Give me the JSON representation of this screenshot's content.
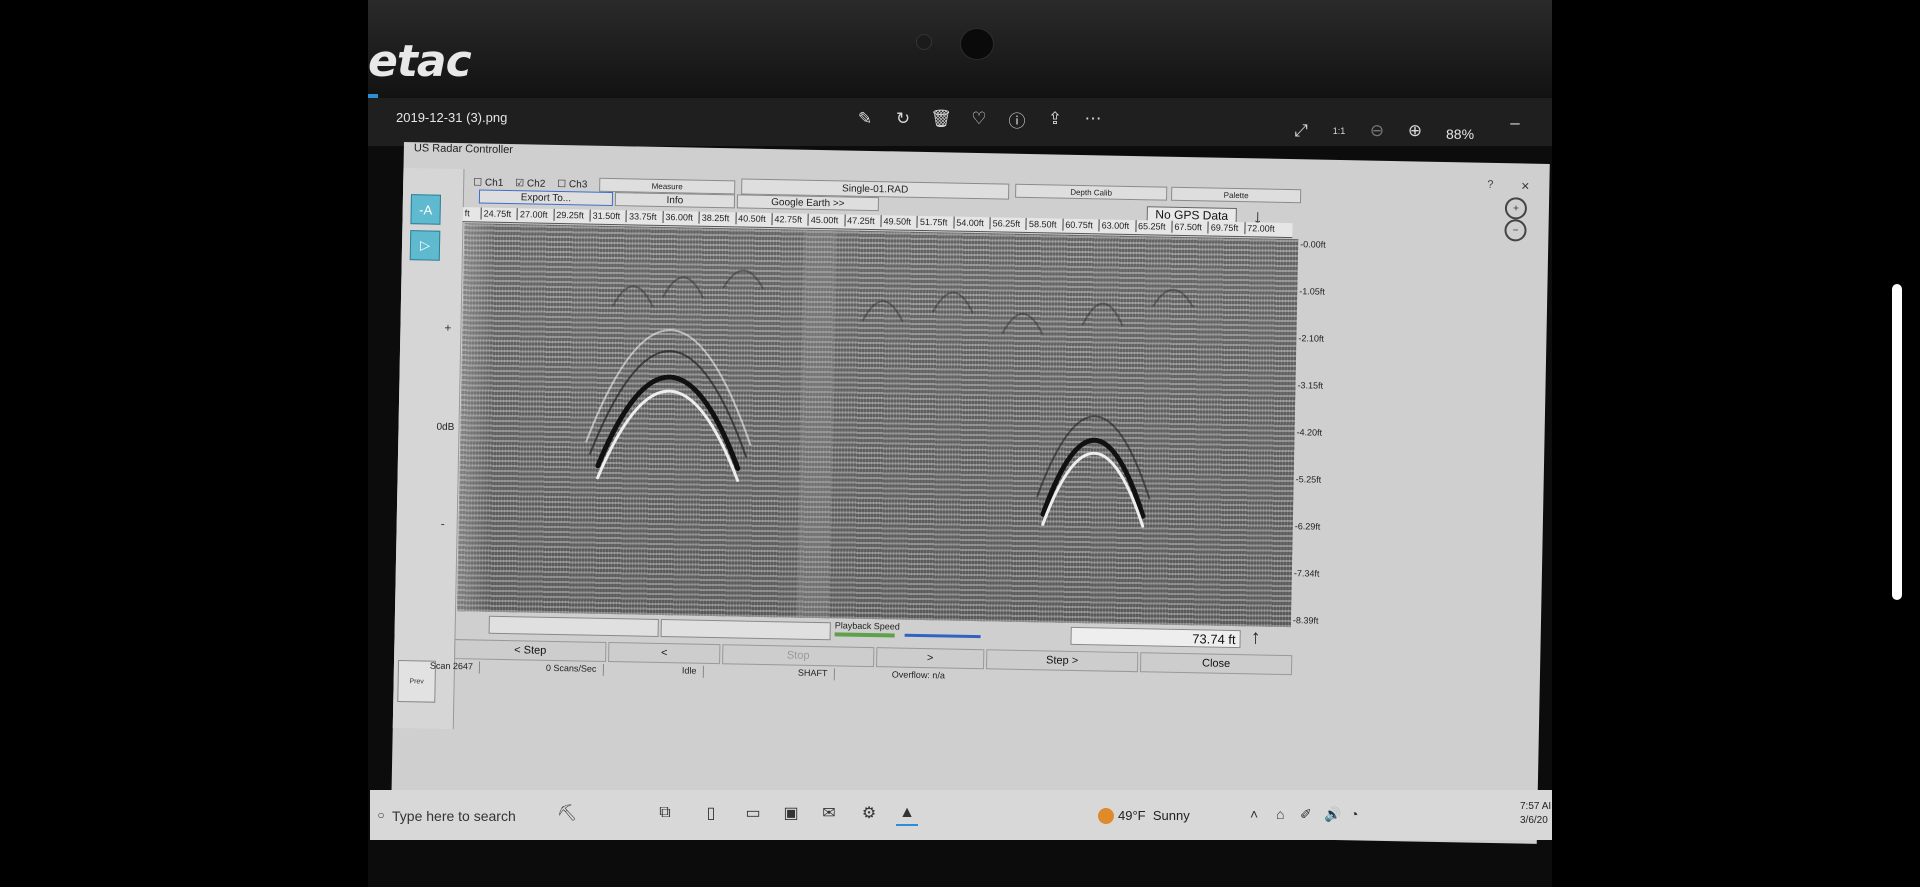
{
  "viewer": {
    "brand": "etac",
    "file_name": "2019-12-31 (3).png",
    "zoom": "88%",
    "zoom_fit_label": "1:1",
    "toolbar_icons": [
      "edit-icon",
      "rotate-icon",
      "delete-icon",
      "favorite-icon",
      "info-icon",
      "share-icon",
      "more-icon"
    ]
  },
  "app": {
    "title": "US Radar Controller",
    "help": "?",
    "close": "×",
    "channels": [
      {
        "label": "Ch1",
        "checked": false
      },
      {
        "label": "Ch2",
        "checked": true
      },
      {
        "label": "Ch3",
        "checked": false
      }
    ],
    "buttons": {
      "measure": "Measure",
      "file_field": "Single-01.RAD",
      "depth_calib": "Depth Calib",
      "palette": "Palette",
      "export": "Export To...",
      "info": "Info",
      "google_earth": "Google Earth >>",
      "gps": "No GPS Data",
      "gain_up_tool": "-A",
      "play_tool": "▷",
      "prev": "Prev"
    },
    "gain": {
      "plus": "+",
      "minus": "-",
      "db": "0dB"
    },
    "ruler_unit": "ft",
    "ruler_ticks": [
      "24.75ft",
      "27.00ft",
      "29.25ft",
      "31.50ft",
      "33.75ft",
      "36.00ft",
      "38.25ft",
      "40.50ft",
      "42.75ft",
      "45.00ft",
      "47.25ft",
      "49.50ft",
      "51.75ft",
      "54.00ft",
      "56.25ft",
      "58.50ft",
      "60.75ft",
      "63.00ft",
      "65.25ft",
      "67.50ft",
      "69.75ft",
      "72.00ft"
    ],
    "depth_ticks": [
      "0.00ft",
      "1.05ft",
      "2.10ft",
      "3.15ft",
      "4.20ft",
      "5.25ft",
      "6.29ft",
      "7.34ft",
      "8.39ft"
    ],
    "playback_label": "Playback Speed",
    "distance": "73.74 ft",
    "nav": {
      "step_back": "< Step",
      "back": "<",
      "stop": "Stop",
      "forward": ">",
      "step_forward": "Step >",
      "close": "Close"
    },
    "status": {
      "scan": "Scan 2647",
      "rate": "0 Scans/Sec",
      "state": "Idle",
      "mode": "SHAFT",
      "overflow": "Overflow: n/a"
    }
  },
  "taskbar": {
    "search_placeholder": "Type here to search",
    "weather_temp": "49°F",
    "weather_desc": "Sunny",
    "time": "7:57 AI",
    "date": "3/6/20"
  }
}
